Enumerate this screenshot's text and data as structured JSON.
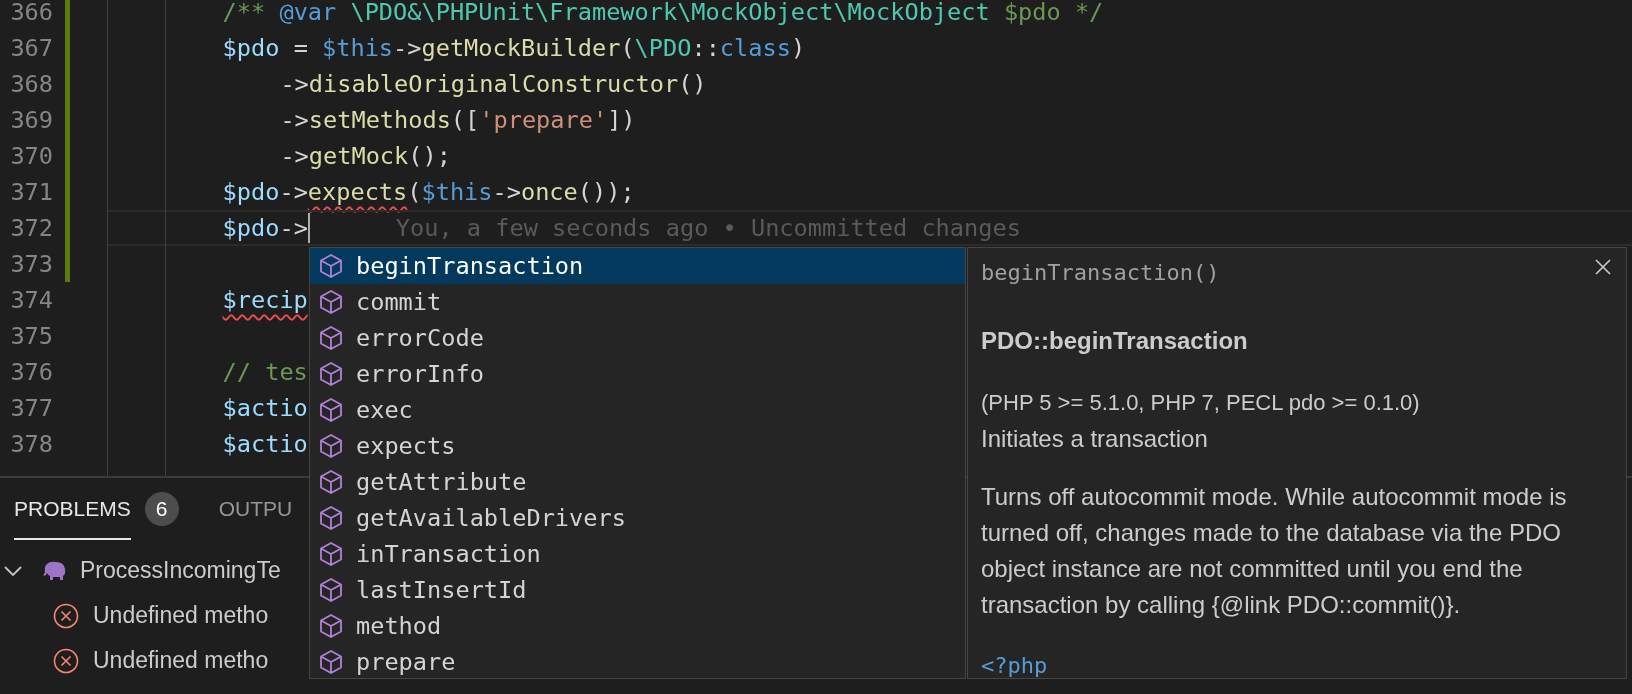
{
  "editor": {
    "lines": [
      {
        "number": "366",
        "modified": true,
        "active": false,
        "kind": "statement",
        "tokens": [
          {
            "kind": "comment",
            "text": "/** "
          },
          {
            "kind": "keyword",
            "text": "@var"
          },
          {
            "kind": "type",
            "text": " \\PDO&\\PHPUnit\\Framework\\MockObject\\MockObject"
          },
          {
            "kind": "comment",
            "text": " $pdo */"
          }
        ]
      },
      {
        "number": "367",
        "modified": true,
        "active": false,
        "kind": "statement",
        "tokens": [
          {
            "kind": "var",
            "text": "$pdo"
          },
          {
            "kind": "punct",
            "text": " = "
          },
          {
            "kind": "this",
            "text": "$this"
          },
          {
            "kind": "punct",
            "text": "->"
          },
          {
            "kind": "method",
            "text": "getMockBuilder"
          },
          {
            "kind": "punct",
            "text": "("
          },
          {
            "kind": "type",
            "text": "\\PDO"
          },
          {
            "kind": "punct",
            "text": "::"
          },
          {
            "kind": "keyword",
            "text": "class"
          },
          {
            "kind": "punct",
            "text": ")"
          }
        ]
      },
      {
        "number": "368",
        "modified": true,
        "active": false,
        "kind": "continuation",
        "tokens": [
          {
            "kind": "punct",
            "text": "->"
          },
          {
            "kind": "method",
            "text": "disableOriginalConstructor"
          },
          {
            "kind": "punct",
            "text": "()"
          }
        ]
      },
      {
        "number": "369",
        "modified": true,
        "active": false,
        "kind": "continuation",
        "tokens": [
          {
            "kind": "punct",
            "text": "->"
          },
          {
            "kind": "method",
            "text": "setMethods"
          },
          {
            "kind": "punct",
            "text": "(["
          },
          {
            "kind": "string",
            "text": "'prepare'"
          },
          {
            "kind": "punct",
            "text": "])"
          }
        ]
      },
      {
        "number": "370",
        "modified": true,
        "active": false,
        "kind": "continuation",
        "tokens": [
          {
            "kind": "punct",
            "text": "->"
          },
          {
            "kind": "method",
            "text": "getMock"
          },
          {
            "kind": "punct",
            "text": "();"
          }
        ]
      },
      {
        "number": "371",
        "modified": true,
        "active": false,
        "kind": "statement",
        "tokens": [
          {
            "kind": "var",
            "text": "$pdo"
          },
          {
            "kind": "punct",
            "text": "->"
          },
          {
            "kind": "method",
            "text": "expects",
            "error": true
          },
          {
            "kind": "punct",
            "text": "("
          },
          {
            "kind": "this",
            "text": "$this"
          },
          {
            "kind": "punct",
            "text": "->"
          },
          {
            "kind": "method",
            "text": "once"
          },
          {
            "kind": "punct",
            "text": "());"
          }
        ]
      },
      {
        "number": "372",
        "modified": true,
        "active": true,
        "kind": "statement",
        "blame": "You, a few seconds ago • Uncommitted changes",
        "tokens": [
          {
            "kind": "var",
            "text": "$pdo"
          },
          {
            "kind": "punct",
            "text": "->"
          }
        ]
      },
      {
        "number": "373",
        "modified": true,
        "active": false
      },
      {
        "number": "374",
        "modified": false,
        "active": false,
        "kind": "statement",
        "tokens": [
          {
            "kind": "var",
            "text": "$recip",
            "error": true
          }
        ]
      },
      {
        "number": "375",
        "modified": false,
        "active": false
      },
      {
        "number": "376",
        "modified": false,
        "active": false,
        "kind": "statement",
        "tokens": [
          {
            "kind": "comment",
            "text": "// tes"
          }
        ]
      },
      {
        "number": "377",
        "modified": false,
        "active": false,
        "kind": "statement",
        "tokens": [
          {
            "kind": "var",
            "text": "$actio"
          }
        ]
      },
      {
        "number": "378",
        "modified": false,
        "active": false,
        "kind": "statement",
        "tokens": [
          {
            "kind": "var",
            "text": "$actio"
          }
        ]
      }
    ]
  },
  "suggestions": {
    "items": [
      {
        "label": "beginTransaction",
        "selected": true
      },
      {
        "label": "commit",
        "selected": false
      },
      {
        "label": "errorCode",
        "selected": false
      },
      {
        "label": "errorInfo",
        "selected": false
      },
      {
        "label": "exec",
        "selected": false
      },
      {
        "label": "expects",
        "selected": false
      },
      {
        "label": "getAttribute",
        "selected": false
      },
      {
        "label": "getAvailableDrivers",
        "selected": false
      },
      {
        "label": "inTransaction",
        "selected": false
      },
      {
        "label": "lastInsertId",
        "selected": false
      },
      {
        "label": "method",
        "selected": false
      },
      {
        "label": "prepare",
        "selected": false
      }
    ],
    "details": {
      "signature": "beginTransaction()",
      "heading": "PDO::beginTransaction",
      "versions": "(PHP 5 >= 5.1.0, PHP 7, PECL pdo >= 0.1.0)",
      "summary": "Initiates a transaction",
      "description": "Turns off autocommit mode. While autocommit mode is turned off, changes made to the database via the PDO object instance are not committed until you end the transaction by calling {@link PDO::commit()}.",
      "code": "<?php"
    }
  },
  "panel": {
    "tabs": [
      {
        "label": "PROBLEMS",
        "badge": "6",
        "selected": true
      },
      {
        "label": "OUTPU",
        "selected": false
      }
    ],
    "file": {
      "name": "ProcessIncomingTe",
      "expanded": true
    },
    "problems": [
      {
        "message": "Undefined metho"
      },
      {
        "message": "Undefined metho"
      }
    ]
  }
}
